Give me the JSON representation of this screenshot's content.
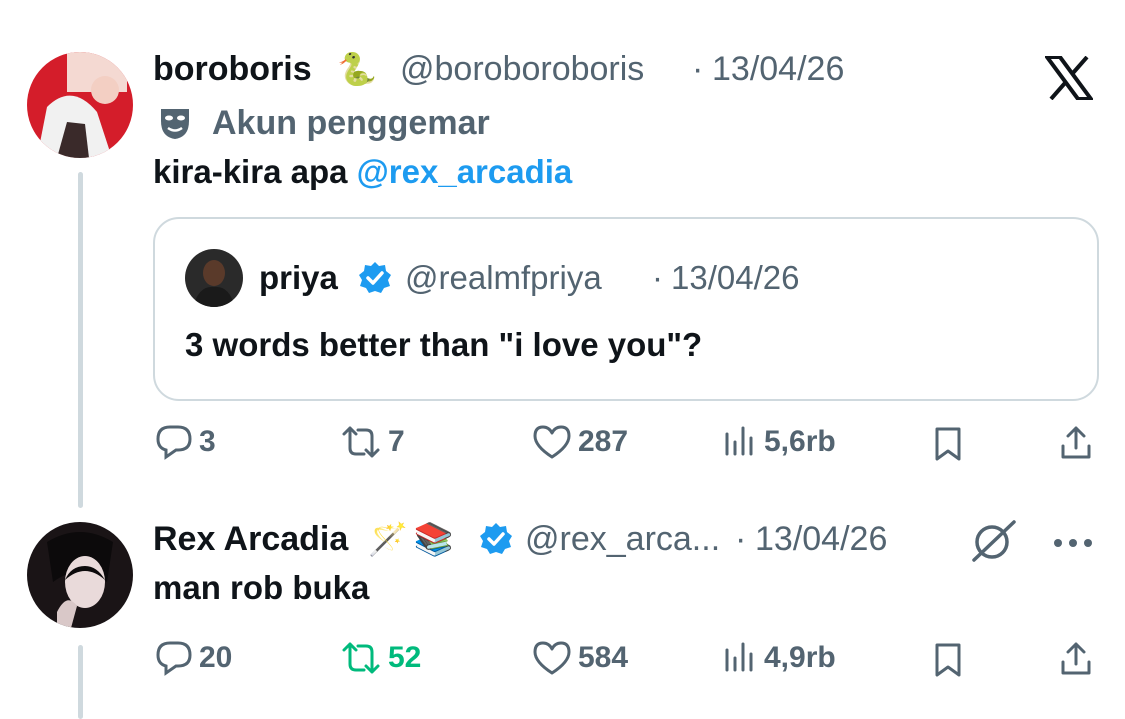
{
  "tweet1": {
    "display_name": "boroboris",
    "name_emoji": "🐍",
    "handle": "@boroboroboris",
    "separator": "·",
    "date": "13/04/26",
    "label": "Akun penggemar",
    "text": "kira-kira apa ",
    "mention": "@rex_arcadia",
    "quote": {
      "display_name": "priya",
      "handle": "@realmfpriya",
      "separator": "·",
      "date": "13/04/26",
      "text": "3 words better than \"i love you\"?"
    },
    "stats": {
      "replies": "3",
      "reposts": "7",
      "likes": "287",
      "views": "5,6rb"
    }
  },
  "tweet2": {
    "display_name": "Rex Arcadia",
    "name_emoji": "🪄📚",
    "handle": "@rex_arca...",
    "separator": "·",
    "date": "13/04/26",
    "text": "man rob buka",
    "stats": {
      "replies": "20",
      "reposts": "52",
      "likes": "584",
      "views": "4,9rb"
    }
  },
  "colors": {
    "accent": "#1d9bf0",
    "muted": "#536471",
    "repost_active": "#00ba7c"
  },
  "icons": [
    "x-logo-icon",
    "fan-mask-icon",
    "verified-badge-icon",
    "reply-icon",
    "repost-icon",
    "like-icon",
    "views-icon",
    "bookmark-icon",
    "share-icon",
    "grok-icon",
    "more-icon"
  ]
}
